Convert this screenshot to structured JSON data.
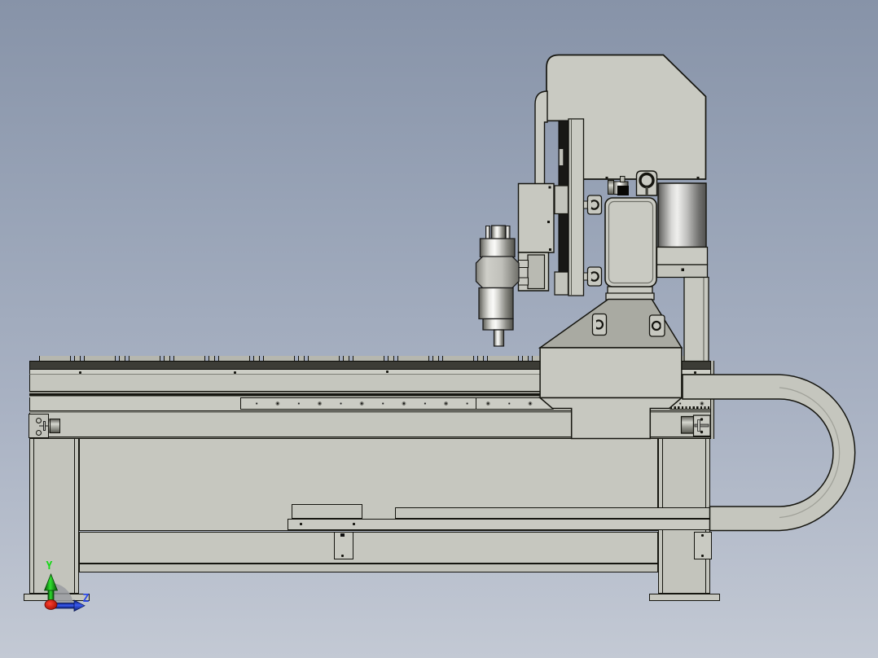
{
  "viewport": {
    "description": "3D CAD side view of a CNC router machine",
    "background_top_color": "#8793a8",
    "background_bottom_color": "#c3c9d4"
  },
  "triad": {
    "y_label": "Y",
    "z_label": "Z",
    "y_axis_color": "#16d816",
    "z_axis_color": "#2b49e8",
    "x_marker_color": "#d41414"
  },
  "machine": {
    "body_color": "#c7c8c0",
    "top_face_color": "#a9aaa2",
    "outline_color": "#15150f",
    "rail_color": "#181816",
    "metal_highlight_color": "#fafaf8",
    "visible_parts": [
      "t-slot-bed",
      "linear-rail",
      "gear-rack",
      "gantry-column",
      "dust-funnel",
      "y-carriage",
      "z-axis-plate",
      "spindle-motor",
      "head-cover",
      "lifting-eyebolt",
      "cable-chain",
      "cable-tray",
      "stepper-motor-left",
      "stepper-motor-right",
      "leg-left",
      "leg-right",
      "foot-left",
      "foot-right"
    ]
  }
}
